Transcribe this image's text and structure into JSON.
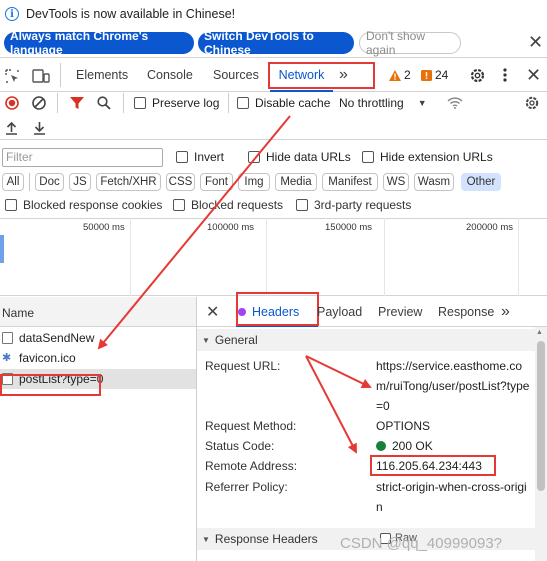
{
  "infobar": {
    "message": "DevTools is now available in Chinese!",
    "btn_match": "Always match Chrome's language",
    "btn_switch": "Switch DevTools to Chinese",
    "btn_dismiss": "Don't show again",
    "close": "✕"
  },
  "tabs": {
    "elements": "Elements",
    "console": "Console",
    "sources": "Sources",
    "network": "Network",
    "more": "»",
    "warnings": "2",
    "issues": "24"
  },
  "network_toolbar": {
    "preserve_log": "Preserve log",
    "disable_cache": "Disable cache",
    "throttling": "No throttling"
  },
  "filter": {
    "placeholder": "Filter",
    "invert": "Invert",
    "hide_data_urls": "Hide data URLs",
    "hide_extension_urls": "Hide extension URLs"
  },
  "chips": [
    "All",
    "Doc",
    "JS",
    "Fetch/XHR",
    "CSS",
    "Font",
    "Img",
    "Media",
    "Manifest",
    "WS",
    "Wasm",
    "Other"
  ],
  "selected_chip": "Other",
  "blocked": {
    "blocked_cookies": "Blocked response cookies",
    "blocked_requests": "Blocked requests",
    "third_party": "3rd-party requests"
  },
  "timeline": [
    "50000 ms",
    "100000 ms",
    "150000 ms",
    "200000 ms"
  ],
  "requests": {
    "header": "Name",
    "items": [
      "dataSendNew",
      "favicon.ico",
      "postList?type=0"
    ]
  },
  "details": {
    "close": "✕",
    "tabs": [
      "Headers",
      "Payload",
      "Preview",
      "Response",
      "»"
    ],
    "general_section": "General",
    "request_url_label": "Request URL:",
    "request_url_value_1": "https://service.easthome.co",
    "request_url_value_2": "m/ruiTong/user/postList?type",
    "request_url_value_3": "=0",
    "request_method_label": "Request Method:",
    "request_method_value": "OPTIONS",
    "status_code_label": "Status Code:",
    "status_code_value": "200 OK",
    "remote_address_label": "Remote Address:",
    "remote_address_value": "116.205.64.234:443",
    "referrer_policy_label": "Referrer Policy:",
    "referrer_policy_value_1": "strict-origin-when-cross-origi",
    "referrer_policy_value_2": "n",
    "response_headers_section": "Response Headers",
    "raw_label": "Raw"
  },
  "watermark": "CSDN @qq_40999093?",
  "colors": {
    "accent": "#0b57d0",
    "annotation_red": "#e53935",
    "status_green": "#188038",
    "record_red": "#d93025"
  }
}
